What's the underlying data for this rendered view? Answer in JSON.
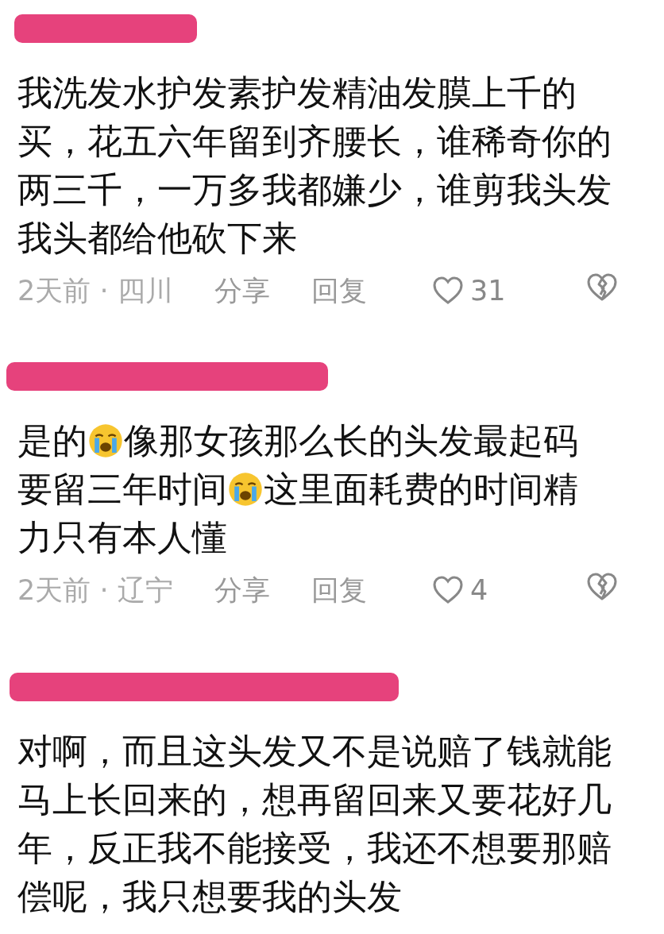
{
  "comments": [
    {
      "text_parts": [
        {
          "kind": "text",
          "text": "我洗发水护发素护发精油发膜上千的买，花五六年留到齐腰长，谁稀奇你的两三千，一万多我都嫌少，谁剪我头发我头都给他砍下来"
        }
      ],
      "meta": "2天前 · 四川",
      "share": "分享",
      "reply": "回复",
      "likes": "31"
    },
    {
      "text_parts": [
        {
          "kind": "text",
          "text": "是的"
        },
        {
          "kind": "emoji"
        },
        {
          "kind": "text",
          "text": "像那女孩那么长的头发最起码"
        },
        {
          "kind": "text",
          "text": "要留三年时间"
        },
        {
          "kind": "emoji"
        },
        {
          "kind": "text",
          "text": "这里面耗费的时间精"
        },
        {
          "kind": "text",
          "text": "力只有本人懂"
        }
      ],
      "meta": "2天前 · 辽宁",
      "share": "分享",
      "reply": "回复",
      "likes": "4"
    },
    {
      "text_parts": [
        {
          "kind": "text",
          "text": "对啊，而且这头发又不是说赔了钱就能马上长回来的，想再留回来又要花好几年，反正我不能接受，我还不想要那赔偿呢，我只想要我的头发"
        }
      ]
    }
  ]
}
